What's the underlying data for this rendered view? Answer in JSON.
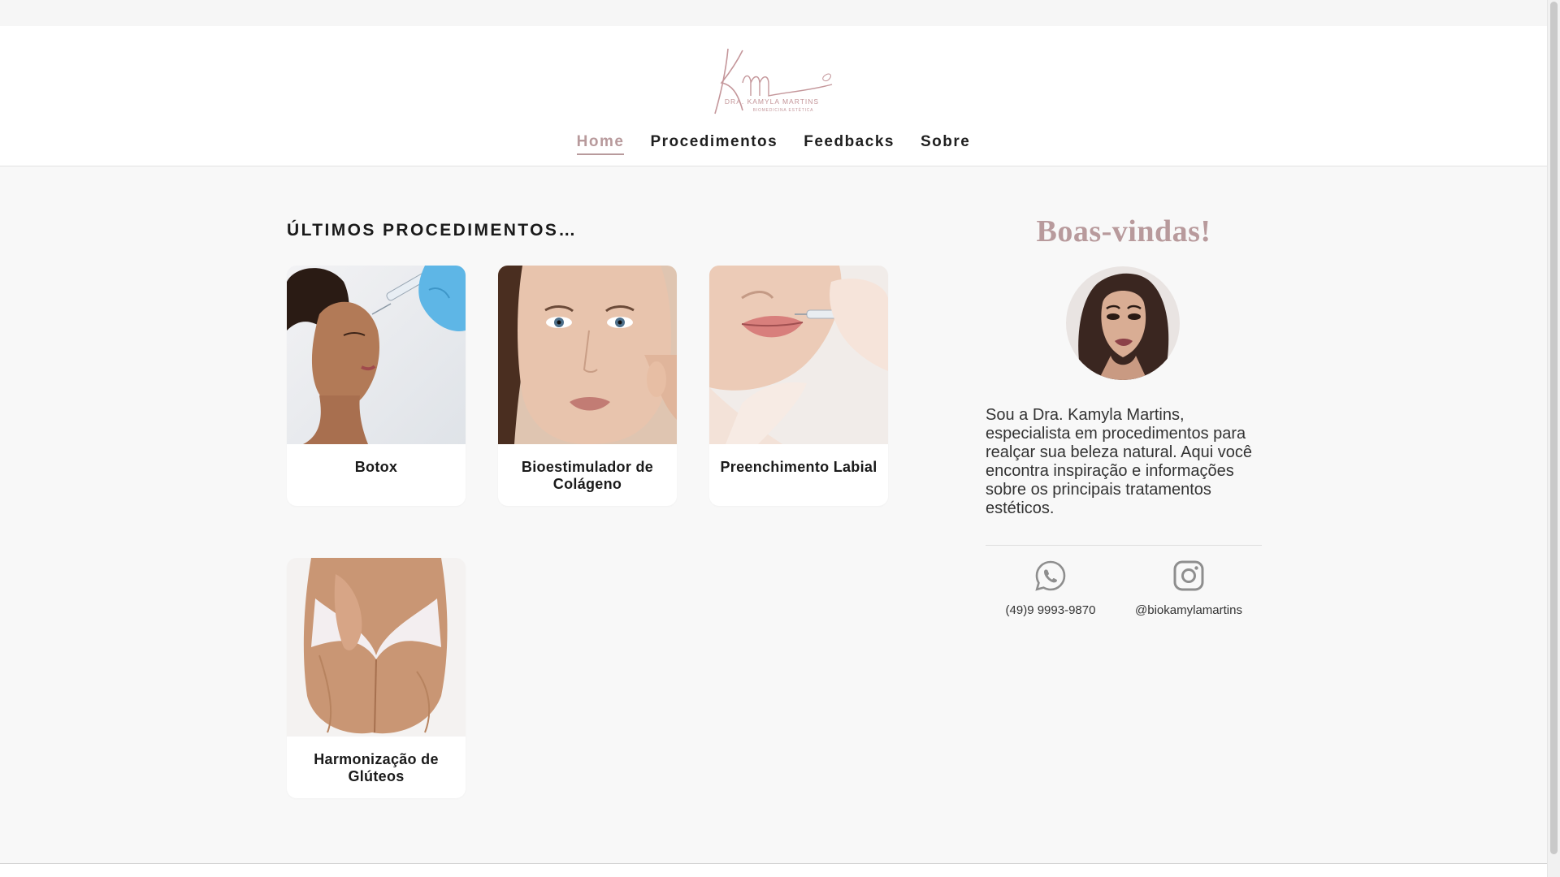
{
  "brand": {
    "logo_monogram": "Km",
    "logo_name": "DRA. KAMYLA MARTINS",
    "logo_tagline": "BIOMEDICINA ESTÉTICA",
    "accent_color": "#b89a9c"
  },
  "nav": {
    "items": [
      {
        "label": "Home",
        "active": true
      },
      {
        "label": "Procedimentos",
        "active": false
      },
      {
        "label": "Feedbacks",
        "active": false
      },
      {
        "label": "Sobre",
        "active": false
      }
    ]
  },
  "main": {
    "section_title": "ÚLTIMOS PROCEDIMENTOS…",
    "cards": [
      {
        "title": "Botox",
        "image": "botox-injection-photo"
      },
      {
        "title": "Bioestimulador de Colágeno",
        "image": "collagen-face-photo"
      },
      {
        "title": "Preenchimento Labial",
        "image": "lip-filler-photo"
      },
      {
        "title": "Harmonização de Glúteos",
        "image": "gluteal-photo"
      }
    ]
  },
  "sidebar": {
    "welcome": "Boas-vindas!",
    "avatar": "doctor-portrait",
    "bio": "Sou a Dra. Kamyla Martins, especialista em procedimentos para realçar sua beleza natural. Aqui você encontra inspiração e informações sobre os principais tratamentos estéticos.",
    "contacts": [
      {
        "icon": "whatsapp-icon",
        "label": "(49)9 9993-9870"
      },
      {
        "icon": "instagram-icon",
        "label": "@biokamylamartins"
      }
    ]
  }
}
